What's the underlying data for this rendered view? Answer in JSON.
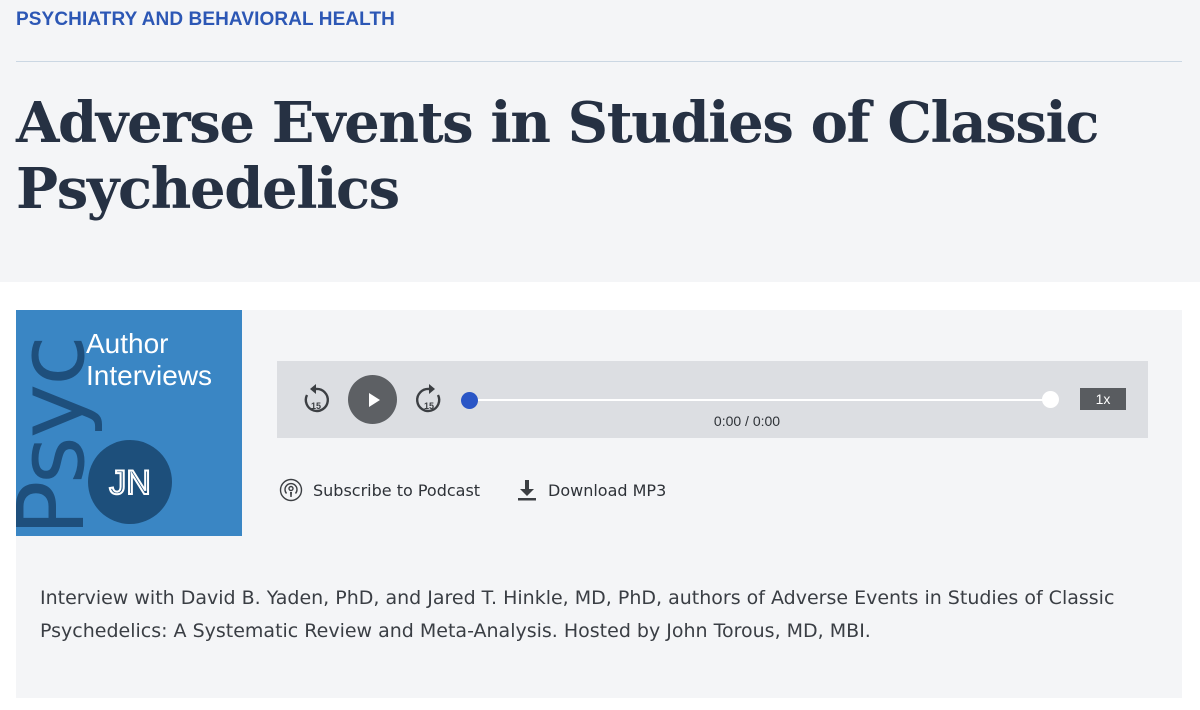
{
  "section": {
    "label": "PSYCHIATRY AND BEHAVIORAL HEALTH"
  },
  "article": {
    "title": "Adverse Events in Studies of Classic Psychedelics"
  },
  "podcast": {
    "cover": {
      "vertical_word": "Psyc",
      "title_line_1": "Author",
      "title_line_2": "Interviews",
      "badge": "JN"
    },
    "player": {
      "skip_back_icon": "rewind-15-icon",
      "skip_back_seconds": "15",
      "play_icon": "play-icon",
      "skip_forward_icon": "forward-15-icon",
      "skip_forward_seconds": "15",
      "time": "0:00 / 0:00",
      "speed": "1x",
      "progress": 0
    },
    "actions": {
      "subscribe_icon": "podcast-icon",
      "subscribe_label": "Subscribe to Podcast",
      "download_icon": "download-icon",
      "download_label": "Download MP3"
    },
    "description": "Interview with David B. Yaden, PhD, and Jared T. Hinkle, MD, PhD, authors of Adverse Events in Studies of Classic Psychedelics: A Systematic Review and Meta-Analysis. Hosted by John Torous, MD, MBI."
  },
  "colors": {
    "accent": "#2c57b5",
    "title": "#263143",
    "cover_blue": "#3a86c4",
    "cover_dark": "#1d4f7b",
    "player_bg": "#dcdee2",
    "progress_dot": "#2a56c6"
  }
}
